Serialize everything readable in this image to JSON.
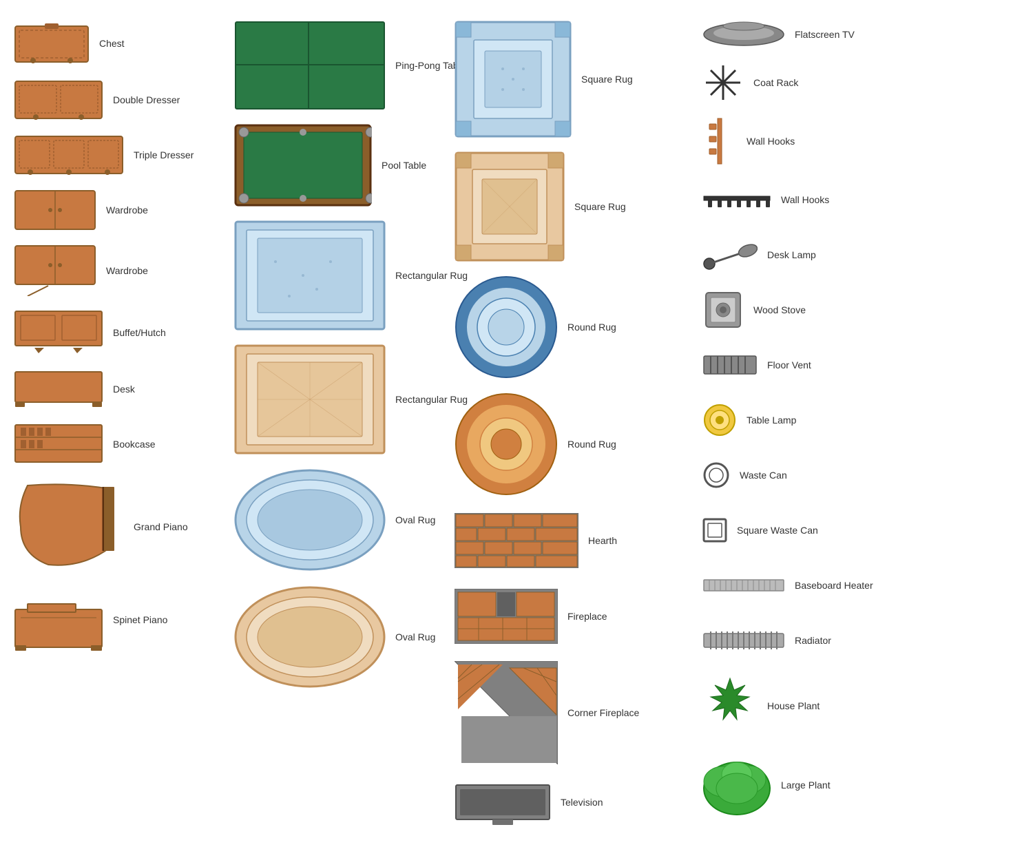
{
  "items": {
    "col1": [
      {
        "id": "chest",
        "label": "Chest"
      },
      {
        "id": "double-dresser",
        "label": "Double Dresser"
      },
      {
        "id": "triple-dresser",
        "label": "Triple Dresser"
      },
      {
        "id": "wardrobe1",
        "label": "Wardrobe"
      },
      {
        "id": "wardrobe2",
        "label": "Wardrobe"
      },
      {
        "id": "buffet",
        "label": "Buffet/Hutch"
      },
      {
        "id": "desk",
        "label": "Desk"
      },
      {
        "id": "bookcase",
        "label": "Bookcase"
      },
      {
        "id": "grand-piano",
        "label": "Grand Piano"
      },
      {
        "id": "spinet-piano",
        "label": "Spinet Piano"
      }
    ],
    "col2": [
      {
        "id": "ping-pong",
        "label": "Ping-Pong Table"
      },
      {
        "id": "pool-table",
        "label": "Pool Table"
      },
      {
        "id": "rect-rug1",
        "label": "Rectangular Rug"
      },
      {
        "id": "rect-rug2",
        "label": "Rectangular Rug"
      },
      {
        "id": "oval-rug1",
        "label": "Oval Rug"
      },
      {
        "id": "oval-rug2",
        "label": "Oval Rug"
      }
    ],
    "col3": [
      {
        "id": "square-rug1",
        "label": "Square Rug"
      },
      {
        "id": "square-rug2",
        "label": "Square Rug"
      },
      {
        "id": "round-rug1",
        "label": "Round Rug"
      },
      {
        "id": "round-rug2",
        "label": "Round Rug"
      },
      {
        "id": "hearth",
        "label": "Hearth"
      },
      {
        "id": "fireplace",
        "label": "Fireplace"
      },
      {
        "id": "corner-fireplace",
        "label": "Corner Fireplace"
      },
      {
        "id": "television",
        "label": "Television"
      }
    ],
    "col4": [
      {
        "id": "flatscreen-tv",
        "label": "Flatscreen TV"
      },
      {
        "id": "coat-rack",
        "label": "Coat Rack"
      },
      {
        "id": "wall-hooks1",
        "label": "Wall Hooks"
      },
      {
        "id": "wall-hooks2",
        "label": "Wall Hooks"
      },
      {
        "id": "desk-lamp",
        "label": "Desk Lamp"
      },
      {
        "id": "wood-stove",
        "label": "Wood Stove"
      },
      {
        "id": "floor-vent",
        "label": "Floor Vent"
      },
      {
        "id": "table-lamp",
        "label": "Table Lamp"
      },
      {
        "id": "waste-can",
        "label": "Waste Can"
      },
      {
        "id": "square-waste-can",
        "label": "Square Waste Can"
      },
      {
        "id": "baseboard-heater",
        "label": "Baseboard Heater"
      },
      {
        "id": "radiator",
        "label": "Radiator"
      },
      {
        "id": "house-plant",
        "label": "House Plant"
      },
      {
        "id": "large-plant",
        "label": "Large Plant"
      }
    ]
  }
}
